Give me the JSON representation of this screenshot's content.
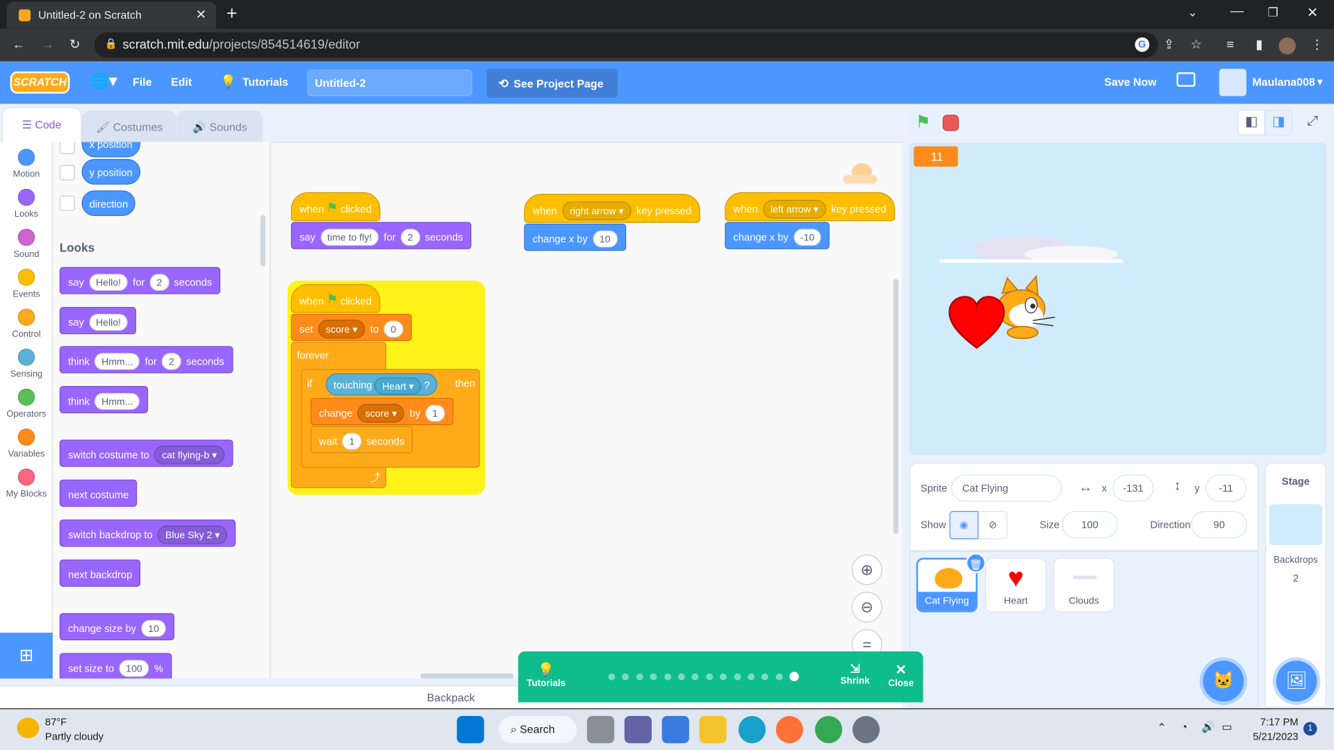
{
  "browser": {
    "tab_title": "Untitled-2 on Scratch",
    "url_host": "scratch.mit.edu",
    "url_path": "/projects/854514619/editor"
  },
  "menubar": {
    "logo": "SCRATCH",
    "file": "File",
    "edit": "Edit",
    "tutorials": "Tutorials",
    "project_title": "Untitled-2",
    "see_project": "See Project Page",
    "save_now": "Save Now",
    "username": "Maulana008"
  },
  "editor_tabs": {
    "code": "Code",
    "costumes": "Costumes",
    "sounds": "Sounds"
  },
  "categories": [
    {
      "label": "Motion",
      "color": "#4c97ff"
    },
    {
      "label": "Looks",
      "color": "#9966ff"
    },
    {
      "label": "Sound",
      "color": "#cf63cf"
    },
    {
      "label": "Events",
      "color": "#ffbf00"
    },
    {
      "label": "Control",
      "color": "#ffab19"
    },
    {
      "label": "Sensing",
      "color": "#5cb1d6"
    },
    {
      "label": "Operators",
      "color": "#59c059"
    },
    {
      "label": "Variables",
      "color": "#ff8c1a"
    },
    {
      "label": "My Blocks",
      "color": "#ff6680"
    }
  ],
  "palette": {
    "x_position": "x position",
    "y_position": "y position",
    "direction": "direction",
    "looks_heading": "Looks",
    "say_for": {
      "say": "say",
      "msg": "Hello!",
      "for": "for",
      "secs": "2",
      "seconds": "seconds"
    },
    "say": {
      "say": "say",
      "msg": "Hello!"
    },
    "think_for": {
      "think": "think",
      "msg": "Hmm...",
      "for": "for",
      "secs": "2",
      "seconds": "seconds"
    },
    "think": {
      "think": "think",
      "msg": "Hmm..."
    },
    "switch_costume": {
      "label": "switch costume to",
      "value": "cat flying-b"
    },
    "next_costume": "next costume",
    "switch_backdrop": {
      "label": "switch backdrop to",
      "value": "Blue Sky 2"
    },
    "next_backdrop": "next backdrop",
    "change_size": {
      "label": "change size by",
      "value": "10"
    },
    "set_size": {
      "label": "set size to",
      "value": "100",
      "unit": "%"
    }
  },
  "scripts": {
    "s1": {
      "when": "when",
      "clicked": "clicked",
      "say": "say",
      "msg": "time to fly!",
      "for": "for",
      "secs": "2",
      "seconds": "seconds"
    },
    "s2": {
      "when": "when",
      "key": "right arrow",
      "pressed": "key pressed",
      "change": "change x by",
      "value": "10"
    },
    "s3": {
      "when": "when",
      "key": "left arrow",
      "pressed": "key pressed",
      "change": "change x by",
      "value": "-10"
    },
    "s4": {
      "when": "when",
      "clicked": "clicked",
      "set": "set",
      "var": "score",
      "to": "to",
      "set_value": "0",
      "forever": "forever",
      "if": "if",
      "touching": "touching",
      "target": "Heart",
      "q": "?",
      "then": "then",
      "change": "change",
      "change_var": "score",
      "by": "by",
      "change_value": "1",
      "wait": "wait",
      "wait_value": "1",
      "wait_unit": "seconds"
    }
  },
  "backpack": "Backpack",
  "stage": {
    "score_display": "11"
  },
  "sprite_info": {
    "sprite_label": "Sprite",
    "sprite_name": "Cat Flying",
    "x_label": "x",
    "x_value": "-131",
    "y_label": "y",
    "y_value": "-11",
    "show_label": "Show",
    "size_label": "Size",
    "size_value": "100",
    "direction_label": "Direction",
    "direction_value": "90"
  },
  "sprites": [
    {
      "name": "Cat Flying",
      "selected": true
    },
    {
      "name": "Heart",
      "selected": false
    },
    {
      "name": "Clouds",
      "selected": false
    }
  ],
  "stage_panel": {
    "title": "Stage",
    "backdrops_label": "Backdrops",
    "backdrops_count": "2"
  },
  "tutorial_bar": {
    "tutorials": "Tutorials",
    "shrink": "Shrink",
    "close": "Close",
    "steps": 14,
    "current_step": 14
  },
  "taskbar": {
    "weather_temp": "87°F",
    "weather_desc": "Partly cloudy",
    "search": "Search",
    "time": "7:17 PM",
    "date": "5/21/2023",
    "notifications": "1"
  },
  "colors": {
    "scratch_blue": "#4c97ff",
    "tutorial_green": "#0fbd8c",
    "glow": "#fff200"
  }
}
